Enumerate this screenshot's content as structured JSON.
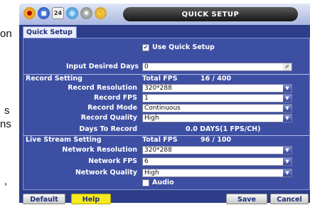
{
  "background_text": [
    "on",
    "s",
    "ns",
    ","
  ],
  "window": {
    "title": "QUICK SETUP",
    "toolbar_icons": [
      "record-icon",
      "camera-icon",
      "calendar-icon",
      "network-icon",
      "settings-icon",
      "hand-icon"
    ],
    "calendar_day": "24"
  },
  "tab": {
    "label": "Quick Setup"
  },
  "use_quick_setup": {
    "label": "Use Quick Setup",
    "checked": true
  },
  "input_days": {
    "label": "Input Desired Days",
    "value": "0"
  },
  "record": {
    "section_label": "Record Setting",
    "total_fps_label": "Total FPS",
    "total_fps_value": "16 / 400",
    "resolution_label": "Record Resolution",
    "resolution_value": "320*288",
    "fps_label": "Record FPS",
    "fps_value": "1",
    "mode_label": "Record Mode",
    "mode_value": "Continuous",
    "quality_label": "Record Quality",
    "quality_value": "High",
    "days_label": "Days To Record",
    "days_value": "0.0 DAYS(1 FPS/CH)"
  },
  "live": {
    "section_label": "Live Stream Setting",
    "total_fps_label": "Total FPS",
    "total_fps_value": "96 / 100",
    "resolution_label": "Network Resolution",
    "resolution_value": "320*288",
    "fps_label": "Network FPS",
    "fps_value": "6",
    "quality_label": "Network Quality",
    "quality_value": "High",
    "audio_label": "Audio",
    "audio_checked": false
  },
  "buttons": {
    "default": "Default",
    "help": "Help",
    "save": "Save",
    "cancel": "Cancel"
  },
  "colors": {
    "frame": "#2d3d8a",
    "panel": "#3d4fa3",
    "help_button": "#f4ea1f"
  }
}
